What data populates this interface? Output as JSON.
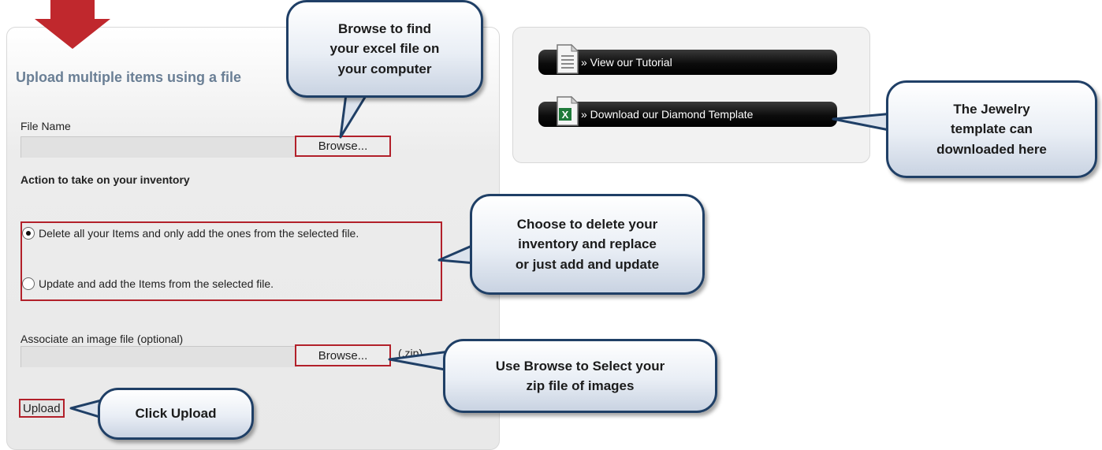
{
  "upload_form": {
    "title": "Upload multiple items using a file",
    "file_name_label": "File Name",
    "browse_label": "Browse...",
    "action_label": "Action to take on your inventory",
    "options": [
      {
        "label": "Delete all your Items and only add the ones from the selected file.",
        "checked": true
      },
      {
        "label": "Update and add the Items from the selected file.",
        "checked": false
      }
    ],
    "image_label": "Associate an image file (optional)",
    "image_browse_label": "Browse...",
    "zip_hint": "(.zip)",
    "upload_label": "Upload"
  },
  "resources": {
    "tutorial_label": "» View our Tutorial",
    "template_label": "» Download our Diamond Template"
  },
  "callouts": {
    "browse": "Browse to find\nyour excel file on\nyour computer",
    "template": "The Jewelry\ntemplate can\ndownloaded here",
    "choose": "Choose to delete your\ninventory and replace\nor just add and update",
    "zip": "Use Browse to Select your\nzip file of images",
    "upload": "Click Upload"
  },
  "colors": {
    "highlight_red": "#b2202a",
    "callout_border": "#1f3f66",
    "title_blue": "#6a7f95"
  }
}
